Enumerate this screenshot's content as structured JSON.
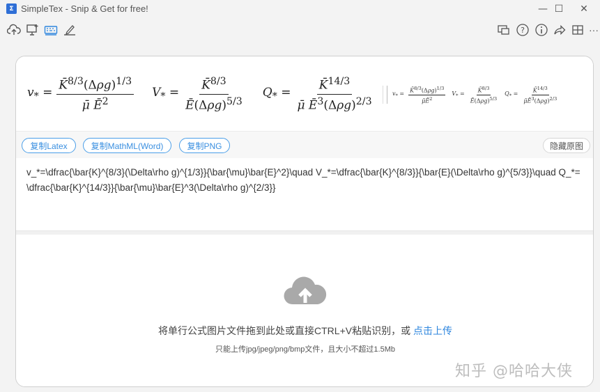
{
  "window": {
    "app_icon_text": "Σ",
    "title": "SimpleTex - Snip & Get for free!",
    "minimize": "—",
    "maximize": "☐",
    "close": "✕"
  },
  "toolbar_left": [
    {
      "name": "upload-cloud-icon"
    },
    {
      "name": "screen-snip-icon"
    },
    {
      "name": "keyboard-icon"
    },
    {
      "name": "handwrite-icon"
    }
  ],
  "toolbar_right": [
    {
      "name": "feedback-icon"
    },
    {
      "name": "help-icon"
    },
    {
      "name": "info-icon"
    },
    {
      "name": "share-icon"
    },
    {
      "name": "layout-icon"
    },
    {
      "name": "more-icon",
      "glyph": "···"
    }
  ],
  "buttons": {
    "copy_latex": "复制Latex",
    "copy_mathml": "复制MathML(Word)",
    "copy_png": "复制PNG",
    "hide_original": "隐藏原图"
  },
  "latex_text": "v_*=\\dfrac{\\bar{K}^{8/3}(\\Delta\\rho g)^{1/3}}{\\bar{\\mu}\\bar{E}^2}\\quad V_*=\\dfrac{\\bar{K}^{8/3}}{\\bar{E}(\\Delta\\rho g)^{5/3}}\\quad Q_*=\\dfrac{\\bar{K}^{14/3}}{\\bar{\\mu}\\bar{E}^3(\\Delta\\rho g)^{2/3}}",
  "upload": {
    "main_text": "将单行公式图片文件拖到此处或直接CTRL+V粘贴识别，或 ",
    "link_text": "点击上传",
    "sub_text": "只能上传jpg/jpeg/png/bmp文件，且大小不超过1.5Mb"
  },
  "watermark": "知乎 @哈哈大侠",
  "colors": {
    "accent": "#3a8fe0",
    "cloud": "#a9a9a9"
  }
}
